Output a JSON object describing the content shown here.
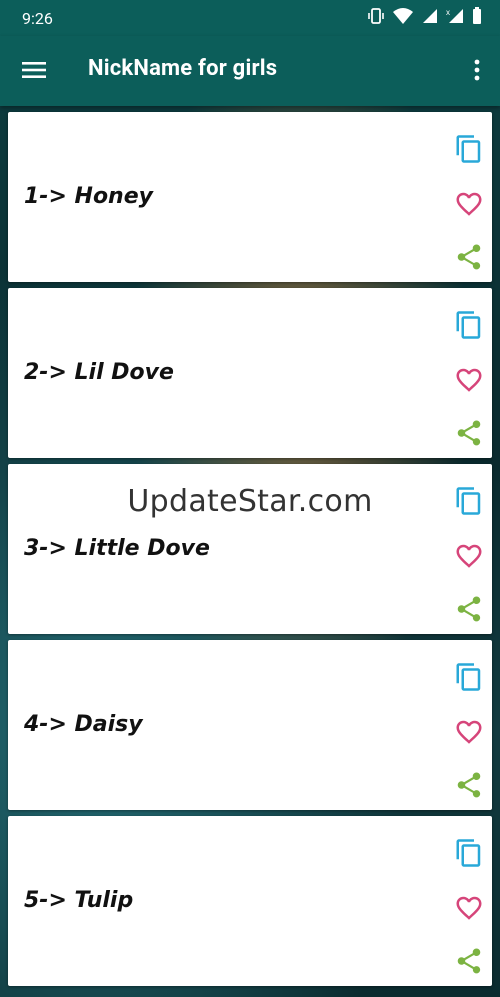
{
  "status": {
    "time": "9:26"
  },
  "appbar": {
    "title": "NickName for girls"
  },
  "items": [
    {
      "label": "1->  Honey"
    },
    {
      "label": "2->  Lil Dove"
    },
    {
      "label": "3->  Little Dove"
    },
    {
      "label": "4->  Daisy"
    },
    {
      "label": "5->  Tulip"
    }
  ],
  "watermark": "UpdateStar.com",
  "colors": {
    "appbar": "#0c5e5a",
    "copy": "#29a8d8",
    "heart": "#d6457a",
    "share": "#7cb342"
  }
}
